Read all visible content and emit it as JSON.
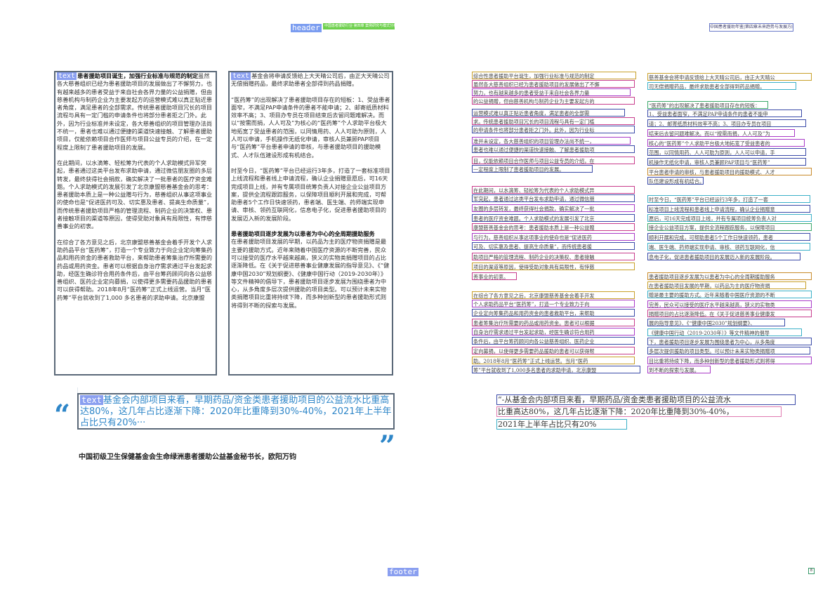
{
  "markers": {
    "header": "header",
    "text": "text",
    "footer": "footer"
  },
  "header": {
    "stripe_text": "中国患者援助行业·第四章 案例研究与模式分析",
    "running_title": "中国患者援助年鉴|第四章未来趋势与发展方向"
  },
  "left": {
    "col1": {
      "p1_lead": "患者援助项目诞生，加强行业标准与规范的制定",
      "p1": "虽然各大慈善组织已经为患者援助项目的发展做出了不懈努力，也有越来越多的患者受益于来自社会各界力量的公益捐赠，但由慈善机构与制药企业为主要发起方的运营模式难以真正贴近患者角度，满足患者的全部需求。传统患者援助项目冗长的项目流程与具有一定门槛的申请条件也将部分患者拒之门外。此外，因为行业标准并未设定，各大慈善组织的项目管理办法尚不统一，患者也难以通过便捷的渠道快速接触、了解患者援助项目，仅能依赖项目合作医师与项目公益专员的介绍，在一定程度上限制了患者援助项目的发展。",
      "p2": "在此期间，以水滴筹、轻松筹为代表的个人求助模式异军突起，患者通过这类平台发布求助申请，通过微信朋友圈的多层转发，最终获得社会捐款，确实解决了一批患者的医疗资金难题。个人求助模式的发展引发了北京康盟慈善基金会的思考：患者援助本质上是一种公益赠与行为，慈善组织从事这项事业的使命也是“促进医药可及、切实惠及患者、提高生命质量”，而传统患者援助项目严格的管理流程、制药企业的决策权、患者接触项目的渠道等原因，使得受助对象具有局限性，有悖慈善事业的初衷。",
      "p3": "在综合了各方意见之后，北京康盟慈善基金会着手开发个人求助药品平台“医药筹”，打造一个专业致力于向企业定向筹集药品和用药资金的患者救助平台，来帮助患者筹集治疗所需要的药品或用药资金。患者可以根据自身治疗需求通过平台发起求助，经医生确诊符合用药条件后，由平台筹药顾问向各公益慈善组织、医药企业定向募捐，以使得更多需要药品援助的患者可以获得帮助。2018年8月“医药筹”正式上线运营。当月“医药筹”平台就收到了1,000 多名患者的求助申请。北京康盟"
    },
    "col2": {
      "p1": "基金会将申请反馈给上大天晴公司后，由正大天晴公司无偿捐赠药品，最终求助患者全部得到药品捐赠。",
      "p2": "“医药筹”的出现解决了患者援助项目存在的短板：1、受益患者面窄，不满足PAP申请条件的患者不能申请；2、邮寄纸质材料效率不高；3、项目办专员在项目结束后去留问题难解决。而以“按需而捐，人人可及”为核心的“医药筹”个人求助平台极大地拓宽了受益患者的范围，以同情用药、人人可助为原则，人人可以申请，手机操作无纸化申请，审核人员兼顾PAP项目与“医药筹”平台患者申请的审核，与患者援助项目的援助模式、人才队伍建设形成有机结合。",
      "p3": "时至今日，“医药筹”平台已经运行3年多，打造了一套标准项目上线流程和患者线上申请流程，确认企业捐赠意愿后，可16天完成项目上线，并有专属项目统筹负责人对接企业公益项目方案，提供全流程跟踪服务，以保障项目顺利开展和完成，可帮助患者5个工作日快速领药，患者端、医生端、药师端实现申请、审核、领药互联网化，信息电子化，促进患者援助项目的发展迈入新的发展阶段。",
      "heading": "患者援助项目逐步发展为以患者为中心的全周期援助服务",
      "p4": "在患者援助项目发展的早期，以药品为主的医疗物资捐赠是最主要的援助方式。近年来随着中国医疗资源的不断完善，民众可以接受的医疗水平越来越高，狭义的实物类捐赠项目的占比逐渐降低。在《关于促进慈善事业健康发展的指导意见》、《“健康中国2030”规划纲要》、《健康中国行动（2019-2030年）》等文件精神的倡导下，患者援助项目逐步发展为围绕患者为中心，从多角度多层次提供援助的项目类型。可以预计未来实物类捐赠项目比重将持续下降，而多种创新型的患者援助形式则将得到不断的探索与发展。"
    },
    "quote": "基金会内部项目来看，早期药品/资金类患者援助项目的公益流水比重高达80%，这几年占比逐渐下降：2020年比重降到30%-40%，2021年上半年占比只有20%···",
    "attribution": "中国初级卫生保健基金会生命绿洲患者援助公益基金秘书长，欧阳万钧"
  },
  "right": {
    "col1": [
      "综合性患者援助平台诞生，加强行业标准与规范的制定",
      "虽然各大慈善组织已经为患者援助项目的发展做出了不懈",
      "努力，也有越来越多的患者受益于来自社会各界力量",
      "的公益捐赠，但由慈善机构与制药企业为主要发起方的",
      "运营模式难以真正贴近患者角度，满足患者的全部需",
      "求。传统患者援助项目冗长的项目流程与具有一定门槛",
      "的申请条件也将部分患者拒之门外。此外，因为行业标",
      "准并未设定，各大慈善组织的项目管理办法尚不统一，",
      "患者也难以通过便捷的渠道快速接触、了解患者援助项",
      "目，仅能依赖项目合作医师与项目公益专员的介绍，在",
      "一定程度上限制了患者援助项目的发展。",
      "在此期间，以水滴筹、轻松筹为代表的个人求助模式异",
      "军突起，患者通过这类平台发布求助申请，通过微信朋",
      "友圈的多层转发，最终获得社会捐款，确实解决了一批",
      "患者的医疗资金难题。个人求助模式的发展引发了北京",
      "康盟慈善基金会的思考：患者援助本质上是一种公益赠",
      "与行为，慈善组织从事这项事业的使命也是“促进医药",
      "可及、切实惠及患者、提高生命质量”，而传统患者援",
      "助项目严格的管理流程、制药企业的决策权、患者接触",
      "项目的渠道等原因，使得受助对象具有局限性，有悖慈",
      "善事业的初衷。",
      "在综合了各方意见之后，北京康盟慈善基金会着手开发",
      "个人求助药品平台“医药筹”，打造一个专业致力于向",
      "企业定向筹集药品和用药资金的患者救助平台，来帮助",
      "患者筹集治疗所需要的药品或用药资金。患者可以根据",
      "自身治疗需求通过平台发起求助，经医生确诊符合用药",
      "条件后，由平台筹药顾问向各公益慈善组织、医药企业",
      "定向募捐，以使得更多需要药品援助的患者可以获得帮",
      "助。2018年8月“医药筹”正式上线运营。当月“医药",
      "筹”平台就收到了1,000多名患者的求助申请，北京康盟"
    ],
    "col2": [
      "慈善基金会将申请反馈给上大天晴公司后，由正大天晴公",
      "司无偿捐赠药品，最终求助患者全部得到药品捐赠。",
      "“医药筹”的出现解决了患者援助项目存在的短板：",
      "1、受益患者面窄，不满足PAP申请条件的患者不能申",
      "请；2、邮寄纸质材料效率不高；3、项目办专员在项目",
      "结束后去留问题难解决。而以“按需而捐，人人可及”为",
      "核心的“医药筹”个人求助平台极大地拓宽了受益患者的",
      "范围，以同情用药、人人可助为原则，人人可以申请，手",
      "机操作无纸化申请，审核人员兼顾PAP项目与“医药筹”",
      "平台患者申请的审核，与患者援助项目的援助模式、人才",
      "队伍建设形成有机结合。",
      "时至今日，“医药筹”平台已经运行3年多，打造了一套",
      "标准项目上线流程和患者线上申请流程，确认企业捐赠意",
      "愿后，可16天完成项目上线，并有专属项目统筹负责人对",
      "接企业公益项目方案，提供全流程跟踪服务，以保障项目",
      "顺利开展和完成，可帮助患者5个工作日快速领药，患者",
      "端、医生端、药师端实现申请、审核、领药互联网化，信",
      "息电子化，促进患者援助项目的发展迈入新的发展阶段。",
      "患者援助项目逐步发展为以患者为中心的全周期援助服务",
      "在患者援助项目发展的早期，以药品为主的医疗物资捐",
      "赠是最主要的援助方式。近年来随着中国医疗资源的不断",
      "完善，民众可以接受的医疗水平越来越高，狭义的实物类",
      "捐赠项目的占比逐渐降低。在《关于促进慈善事业健康发",
      "展的指导意见》、《“健康中国2030”规划纲要》、",
      "《健康中国行动（2019-2030年）》等文件精神的倡导",
      "下，患者援助项目逐步发展为围绕患者为中心，从多角度",
      "多层次提供援助的项目类型。可以预计未来实物类捐赠项",
      "目比重将持续下降，而多种创新型的患者援助形式则将得",
      "到不断的探索与发展。"
    ],
    "quote": [
      "“-从基金会内部项目来看，早期药品/资金类患者援助项目的公益流水",
      "比重高达80%，这几年占比逐渐下降：2020年比重降到30%-40%，",
      "2021年上半年占比只有20%"
    ]
  },
  "footer": {
    "page_number": "8"
  },
  "colors": {
    "accent": "#2e86c8",
    "frame": "#5a6878",
    "marker_bg": "#8a9ff0"
  }
}
